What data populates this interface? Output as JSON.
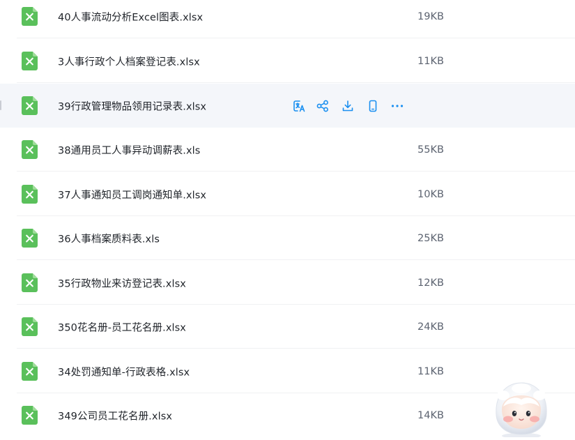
{
  "file_list": {
    "rows": [
      {
        "name": "40人事流动分析Excel图表.xlsx",
        "size": "19KB"
      },
      {
        "name": "3人事行政个人档案登记表.xlsx",
        "size": "11KB"
      },
      {
        "name": "39行政管理物品领用记录表.xlsx",
        "size": ""
      },
      {
        "name": "38通用员工人事异动调薪表.xls",
        "size": "55KB"
      },
      {
        "name": "37人事通知员工调岗通知单.xlsx",
        "size": "10KB"
      },
      {
        "name": "36人事档案质料表.xls",
        "size": "25KB"
      },
      {
        "name": "35行政物业来访登记表.xlsx",
        "size": "12KB"
      },
      {
        "name": "350花名册-员工花名册.xlsx",
        "size": "24KB"
      },
      {
        "name": "34处罚通知单-行政表格.xlsx",
        "size": "11KB"
      },
      {
        "name": "349公司员工花名册.xlsx",
        "size": "14KB"
      }
    ],
    "hovered_row_index": 2,
    "row_actions": [
      {
        "id": "translate",
        "icon": "translate-icon"
      },
      {
        "id": "share",
        "icon": "share-icon"
      },
      {
        "id": "download",
        "icon": "download-icon"
      },
      {
        "id": "send-to-phone",
        "icon": "phone-icon"
      },
      {
        "id": "more",
        "icon": "more-icon"
      }
    ]
  },
  "colors": {
    "excel_icon": "#5ac05b",
    "excel_icon_fold": "#9fdc9a",
    "action_icon": "#1a8ff0",
    "row_hover": "#f4f6fa",
    "divider": "#f0f1f3"
  }
}
